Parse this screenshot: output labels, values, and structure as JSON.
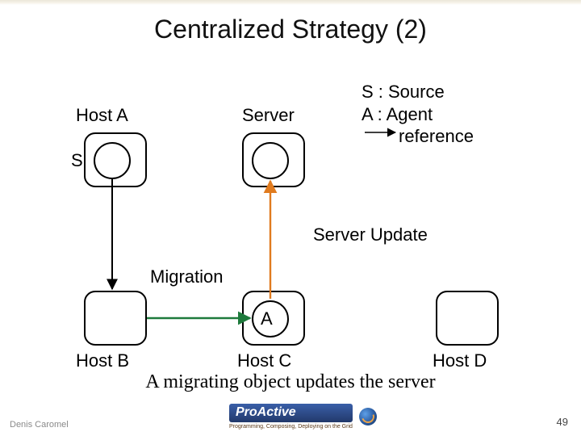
{
  "title": "Centralized Strategy (2)",
  "labels": {
    "hostA": "Host A",
    "server": "Server",
    "hostB": "Host B",
    "hostC": "Host C",
    "hostD": "Host D",
    "S": "S",
    "A": "A",
    "migration": "Migration",
    "serverUpdate": "Server Update"
  },
  "legend": {
    "line1": "S : Source",
    "line2": "A : Agent",
    "line3": "reference"
  },
  "caption": "A migrating object updates the server",
  "footer": {
    "author": "Denis Caromel",
    "page": "49",
    "logo": "ProActive",
    "tagline": "Programming, Composing, Deploying on the Grid"
  }
}
